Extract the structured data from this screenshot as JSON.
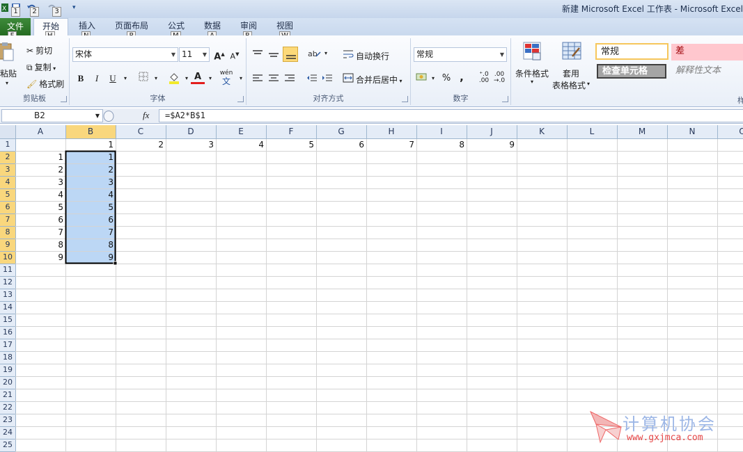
{
  "title_bar": {
    "title": "新建 Microsoft Excel 工作表 - Microsoft Excel",
    "qat_keytips": [
      "1",
      "2",
      "3"
    ]
  },
  "ribbon_tabs": [
    {
      "label": "文件",
      "keytip": "F",
      "active": false
    },
    {
      "label": "开始",
      "keytip": "H",
      "active": true
    },
    {
      "label": "插入",
      "keytip": "N",
      "active": false
    },
    {
      "label": "页面布局",
      "keytip": "P",
      "active": false
    },
    {
      "label": "公式",
      "keytip": "M",
      "active": false
    },
    {
      "label": "数据",
      "keytip": "A",
      "active": false
    },
    {
      "label": "审阅",
      "keytip": "R",
      "active": false
    },
    {
      "label": "视图",
      "keytip": "W",
      "active": false
    }
  ],
  "ribbon": {
    "clipboard": {
      "label": "剪贴板",
      "paste": "粘贴",
      "cut": "剪切",
      "copy": "复制",
      "format_painter": "格式刷"
    },
    "font": {
      "label": "字体",
      "font_name": "宋体",
      "font_size": "11",
      "grow": "A",
      "shrink": "A",
      "bold": "B",
      "italic": "I",
      "underline": "U",
      "font_color_glyph": "A",
      "phonetic": "wén"
    },
    "alignment": {
      "label": "对齐方式",
      "wrap_text": "自动换行",
      "merge_center": "合并后居中"
    },
    "number": {
      "label": "数字",
      "format": "常规",
      "percent": "%",
      "comma": ","
    },
    "styles": {
      "conditional_format": "条件格式",
      "format_as_table_line1": "套用",
      "format_as_table_line2": "表格格式",
      "style_normal": "常规",
      "style_bad": "差",
      "style_check_cell": "检查单元格",
      "style_explanatory": "解释性文本",
      "label_partial": "样"
    }
  },
  "formula_bar": {
    "name_box": "B2",
    "fx": "fx",
    "formula": "=$A2*B$1"
  },
  "sheet": {
    "columns": [
      "A",
      "B",
      "C",
      "D",
      "E",
      "F",
      "G",
      "H",
      "I",
      "J",
      "K",
      "L",
      "M",
      "N",
      "O"
    ],
    "rows": [
      "1",
      "2",
      "3",
      "4",
      "5",
      "6",
      "7",
      "8",
      "9",
      "10",
      "11",
      "12",
      "13",
      "14",
      "15",
      "16",
      "17",
      "18",
      "19",
      "20",
      "21",
      "22",
      "23",
      "24",
      "25"
    ],
    "selected_column": "B",
    "selected_rows": [
      "2",
      "3",
      "4",
      "5",
      "6",
      "7",
      "8",
      "9",
      "10"
    ],
    "row1_values": [
      "",
      "1",
      "2",
      "3",
      "4",
      "5",
      "6",
      "7",
      "8",
      "9"
    ],
    "colA_values": [
      "1",
      "2",
      "3",
      "4",
      "5",
      "6",
      "7",
      "8",
      "9"
    ],
    "colB_values": [
      "1",
      "2",
      "3",
      "4",
      "5",
      "6",
      "7",
      "8",
      "9"
    ]
  },
  "watermark": {
    "text": "计算机协会",
    "url": "www.gxjmca.com"
  },
  "colors": {
    "selection_fill": "#bcd7f5",
    "header_selected": "#f9d77d",
    "file_tab": "#2f7b2b",
    "watermark_red": "#e64646"
  }
}
